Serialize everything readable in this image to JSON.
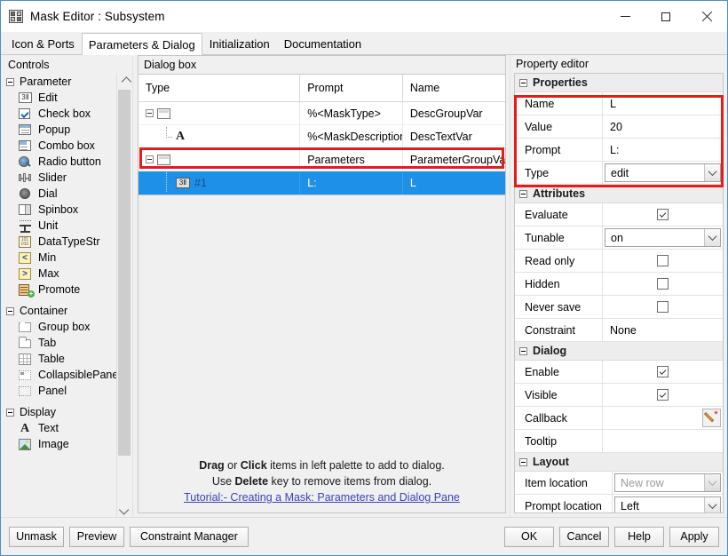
{
  "window": {
    "title": "Mask Editor : Subsystem",
    "icon": "mask-editor-icon",
    "minimize": "minimize-icon",
    "maximize": "maximize-icon",
    "close": "close-icon"
  },
  "tabs": [
    {
      "label": "Icon & Ports",
      "active": false
    },
    {
      "label": "Parameters & Dialog",
      "active": true
    },
    {
      "label": "Initialization",
      "active": false
    },
    {
      "label": "Documentation",
      "active": false
    }
  ],
  "controls": {
    "title": "Controls",
    "groups": [
      {
        "label": "Parameter",
        "items": [
          {
            "label": "Edit",
            "icon": "edit-icon"
          },
          {
            "label": "Check box",
            "icon": "check-box-icon"
          },
          {
            "label": "Popup",
            "icon": "popup-icon"
          },
          {
            "label": "Combo box",
            "icon": "combo-box-icon"
          },
          {
            "label": "Radio button",
            "icon": "radio-button-icon"
          },
          {
            "label": "Slider",
            "icon": "slider-icon"
          },
          {
            "label": "Dial",
            "icon": "dial-icon"
          },
          {
            "label": "Spinbox",
            "icon": "spinbox-icon"
          },
          {
            "label": "Unit",
            "icon": "unit-icon"
          },
          {
            "label": "DataTypeStr",
            "icon": "datatypestr-icon"
          },
          {
            "label": "Min",
            "icon": "min-icon"
          },
          {
            "label": "Max",
            "icon": "max-icon"
          },
          {
            "label": "Promote",
            "icon": "promote-icon"
          }
        ]
      },
      {
        "label": "Container",
        "items": [
          {
            "label": "Group box",
            "icon": "group-box-icon"
          },
          {
            "label": "Tab",
            "icon": "tab-icon"
          },
          {
            "label": "Table",
            "icon": "table-icon"
          },
          {
            "label": "CollapsiblePanel",
            "icon": "collapsible-panel-icon"
          },
          {
            "label": "Panel",
            "icon": "panel-icon"
          }
        ]
      },
      {
        "label": "Display",
        "items": [
          {
            "label": "Text",
            "icon": "text-icon"
          },
          {
            "label": "Image",
            "icon": "image-icon"
          }
        ]
      }
    ]
  },
  "dialog_box": {
    "title": "Dialog box",
    "columns": [
      "Type",
      "Prompt",
      "Name"
    ],
    "rows": [
      {
        "type_icon": "folder-icon",
        "type_label": "",
        "prompt": "%<MaskType>",
        "name": "DescGroupVar",
        "selected": false
      },
      {
        "type_icon": "text-A-icon",
        "type_label": "",
        "prompt": "%<MaskDescription>",
        "name": "DescTextVar",
        "selected": false
      },
      {
        "type_icon": "folder-icon",
        "type_label": "",
        "prompt": "Parameters",
        "name": "ParameterGroupVar",
        "selected": false
      },
      {
        "type_icon": "edit-icon",
        "type_label": "#1",
        "prompt": "L:",
        "name": "L",
        "selected": true
      }
    ],
    "hint": {
      "line1_bold_a": "Drag",
      "line1_mid": " or ",
      "line1_bold_b": "Click",
      "line1_tail": " items in left palette to add to dialog.",
      "line2_head": "Use ",
      "line2_bold": "Delete",
      "line2_tail": " key to remove items from dialog.",
      "link": "Tutorial:- Creating a Mask: Parameters and Dialog Pane"
    }
  },
  "property_editor": {
    "title": "Property editor",
    "sections": [
      {
        "label": "Properties",
        "highlighted": true,
        "rows": [
          {
            "key": "Name",
            "value": "L",
            "widget": "text"
          },
          {
            "key": "Value",
            "value": "20",
            "widget": "text"
          },
          {
            "key": "Prompt",
            "value": "L:",
            "widget": "text"
          },
          {
            "key": "Type",
            "value": "edit",
            "widget": "select",
            "disabled": false
          }
        ]
      },
      {
        "label": "Attributes",
        "highlighted": false,
        "rows": [
          {
            "key": "Evaluate",
            "value": "",
            "widget": "checkbox",
            "checked": true
          },
          {
            "key": "Tunable",
            "value": "on",
            "widget": "select",
            "disabled": false
          },
          {
            "key": "Read only",
            "value": "",
            "widget": "checkbox",
            "checked": false
          },
          {
            "key": "Hidden",
            "value": "",
            "widget": "checkbox",
            "checked": false
          },
          {
            "key": "Never save",
            "value": "",
            "widget": "checkbox",
            "checked": false
          },
          {
            "key": "Constraint",
            "value": "None",
            "widget": "text"
          }
        ]
      },
      {
        "label": "Dialog",
        "highlighted": false,
        "rows": [
          {
            "key": "Enable",
            "value": "",
            "widget": "checkbox",
            "checked": true
          },
          {
            "key": "Visible",
            "value": "",
            "widget": "checkbox",
            "checked": true
          },
          {
            "key": "Callback",
            "value": "",
            "widget": "pencil"
          },
          {
            "key": "Tooltip",
            "value": "",
            "widget": "text"
          }
        ]
      },
      {
        "label": "Layout",
        "highlighted": false,
        "rows": [
          {
            "key": "Item location",
            "value": "New row",
            "widget": "select",
            "disabled": true
          },
          {
            "key": "Prompt location",
            "value": "Left",
            "widget": "select",
            "disabled": false
          }
        ]
      }
    ]
  },
  "footer": {
    "left": [
      "Unmask",
      "Preview",
      "Constraint Manager"
    ],
    "right": [
      "OK",
      "Cancel",
      "Help",
      "Apply"
    ]
  },
  "colors": {
    "selection_blue": "#1e90e8",
    "highlight_red": "#e81b1b",
    "link_blue": "#3a42b8",
    "window_border": "#4a92c8",
    "panel_bg": "#f0f0f0"
  }
}
